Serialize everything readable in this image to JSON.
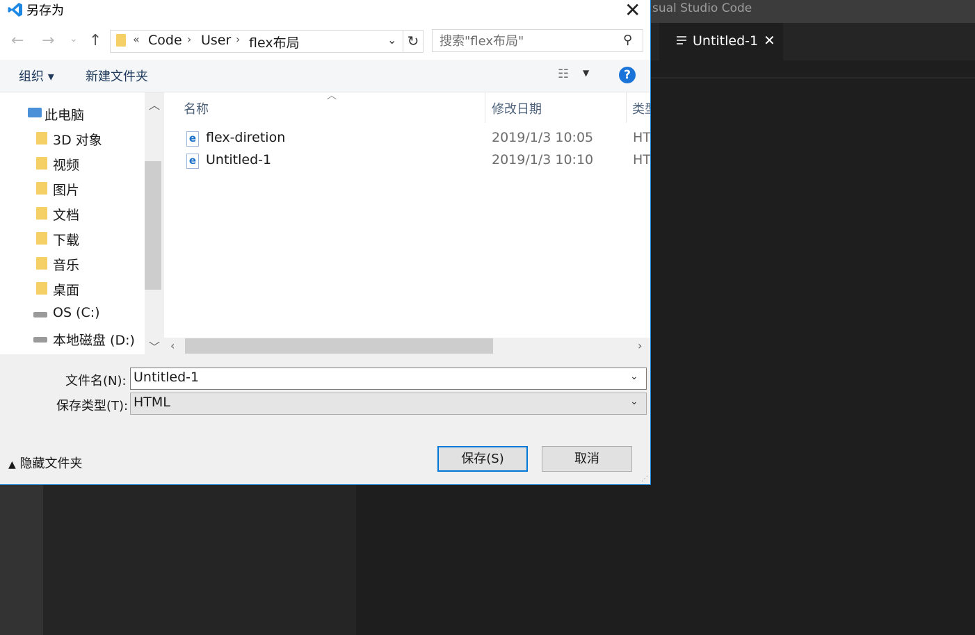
{
  "vscode": {
    "title_partial": "sual Studio Code",
    "tab_label": "Untitled-1",
    "tab_close": "✕"
  },
  "dialog": {
    "title": "另存为",
    "close_glyph": "✕",
    "nav": {
      "back": "←",
      "forward": "→",
      "recent": "⌄",
      "up": "↑",
      "breadcrumb_overflow": "«",
      "breadcrumbs": [
        "Code",
        "User",
        "flex布局"
      ],
      "refresh": "↻",
      "search_placeholder": "搜索\"flex布局\""
    },
    "commands": {
      "organize": "组织 ▾",
      "new_folder": "新建文件夹",
      "help": "?"
    },
    "tree": [
      {
        "label": "此电脑",
        "icon": "pc-icon"
      },
      {
        "label": "3D 对象",
        "icon": "folder-3d-icon"
      },
      {
        "label": "视频",
        "icon": "folder-video-icon"
      },
      {
        "label": "图片",
        "icon": "folder-pictures-icon"
      },
      {
        "label": "文档",
        "icon": "folder-documents-icon"
      },
      {
        "label": "下载",
        "icon": "folder-downloads-icon"
      },
      {
        "label": "音乐",
        "icon": "folder-music-icon"
      },
      {
        "label": "桌面",
        "icon": "folder-desktop-icon"
      },
      {
        "label": "OS (C:)",
        "icon": "drive-c-icon"
      },
      {
        "label": "本地磁盘 (D:)",
        "icon": "drive-d-icon"
      }
    ],
    "columns": {
      "name": "名称",
      "modified": "修改日期",
      "type": "类型"
    },
    "files": [
      {
        "name": "flex-diretion",
        "modified": "2019/1/3 10:05",
        "type": "HTI"
      },
      {
        "name": "Untitled-1",
        "modified": "2019/1/3 10:10",
        "type": "HTI"
      }
    ],
    "form": {
      "filename_label": "文件名(N):",
      "filename_value": "Untitled-1",
      "filetype_label": "保存类型(T):",
      "filetype_value": "HTML"
    },
    "hide_folders": "隐藏文件夹",
    "save_button": "保存(S)",
    "cancel_button": "取消"
  },
  "colors": {
    "accent": "#0078d7",
    "vscode_bg": "#1e1e1e",
    "vscode_titlebar": "#3c3c3c"
  }
}
